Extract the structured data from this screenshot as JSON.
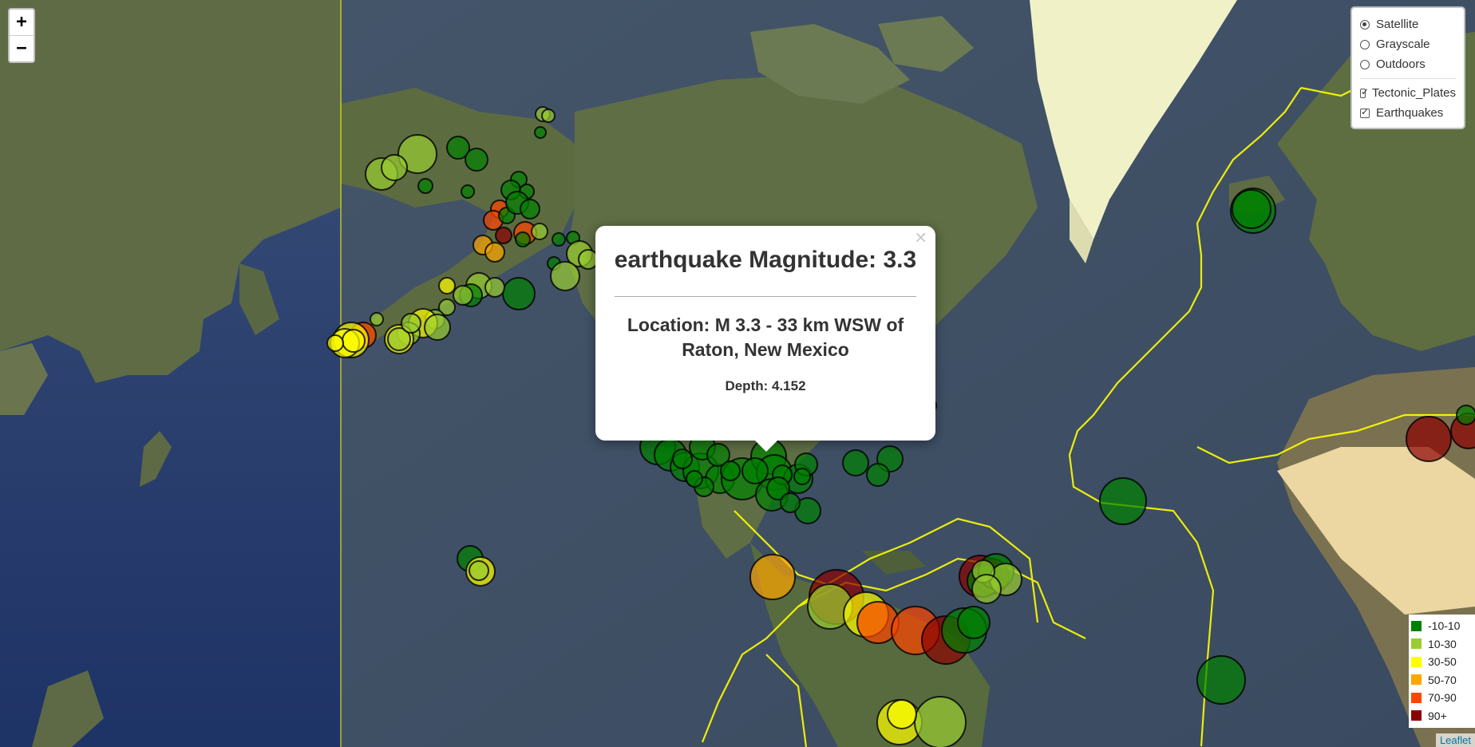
{
  "zoom": {
    "in_label": "+",
    "out_label": "−"
  },
  "layers": {
    "base": [
      {
        "label": "Satellite",
        "checked": true
      },
      {
        "label": "Grayscale",
        "checked": false
      },
      {
        "label": "Outdoors",
        "checked": false
      }
    ],
    "overlays": [
      {
        "label": "Tectonic_Plates",
        "checked": true
      },
      {
        "label": "Earthquakes",
        "checked": true
      }
    ]
  },
  "popup": {
    "close_label": "×",
    "title": "earthquake Magnitude: 3.3",
    "location": "Location: M 3.3 - 33 km WSW of Raton, New Mexico",
    "depth": "Depth: 4.152"
  },
  "legend": {
    "items": [
      {
        "label": "-10-10",
        "color": "#008000"
      },
      {
        "label": "10-30",
        "color": "#9ACD32"
      },
      {
        "label": "30-50",
        "color": "#FFFF00"
      },
      {
        "label": "50-70",
        "color": "#FFA500"
      },
      {
        "label": "70-90",
        "color": "#FF4500"
      },
      {
        "label": "90+",
        "color": "#8B0000"
      }
    ]
  },
  "attribution": "Leaflet",
  "colors": {
    "ocean": "#2d4170",
    "land": "#6b7a4e",
    "ice": "#f1f1c8",
    "plate_line": "#ffff00"
  }
}
